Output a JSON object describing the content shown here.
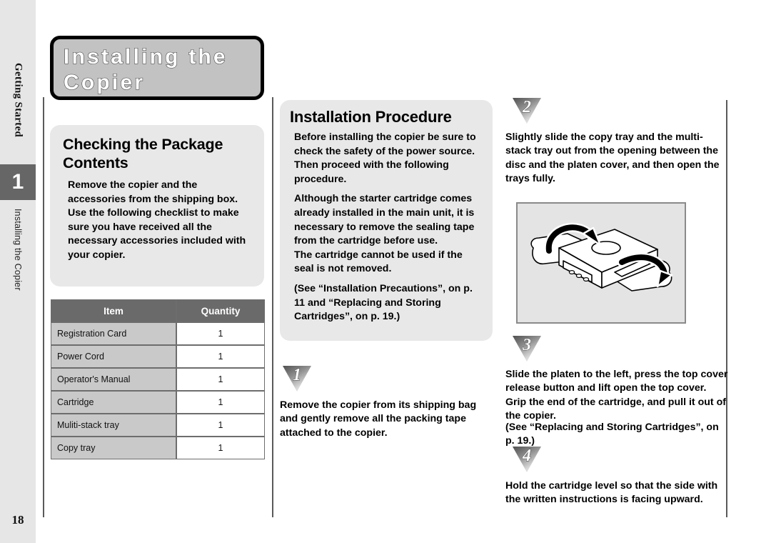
{
  "sidebar": {
    "chapter_label": "Getting Started",
    "tab_number": "1",
    "section_label": "Installing the Copier",
    "page_number": "18"
  },
  "banner": {
    "line1": "Installing the",
    "line2": "Copier"
  },
  "package_panel": {
    "heading": "Checking the Package Contents",
    "body": "Remove the copier and the accessories from the shipping box. Use the following checklist to make sure you have received all the necessary accessories included with your copier."
  },
  "package_table": {
    "headers": [
      "Item",
      "Quantity"
    ],
    "rows": [
      {
        "item": "Registration Card",
        "quantity": "1"
      },
      {
        "item": "Power Cord",
        "quantity": "1"
      },
      {
        "item": "Operator's Manual",
        "quantity": "1"
      },
      {
        "item": "Cartridge",
        "quantity": "1"
      },
      {
        "item": "Muliti-stack tray",
        "quantity": "1"
      },
      {
        "item": "Copy tray",
        "quantity": "1"
      }
    ]
  },
  "procedure_panel": {
    "heading": "Installation Procedure",
    "paragraph1": "Before installing the copier be sure to check the safety of the power source. Then proceed with the following procedure.",
    "paragraph2": "Although the starter cartridge comes already installed in the main unit, it is necessary to remove the sealing tape from the cartridge before use.",
    "paragraph3": "The cartridge cannot be used if the seal is not removed.",
    "paragraph4": "(See “Installation Precautions”, on p. 11 and “Replacing and Storing Cartridges”, on p. 19.)"
  },
  "steps": [
    {
      "number": "1",
      "text": "Remove the copier from its shipping bag and gently remove all the packing tape attached to the copier."
    },
    {
      "number": "2",
      "text": "Slightly slide the copy tray and the multi-stack tray out from the opening between the disc and the platen cover, and then open the trays fully."
    },
    {
      "number": "3",
      "text": "Slide the platen to the left, press the top cover release button and lift open the top cover. Grip the end of the cartridge, and pull it out of the copier.",
      "text2": "(See “Replacing and Storing Cartridges”, on p. 19.)"
    },
    {
      "number": "4",
      "text": "Hold the cartridge level so that the side with the written instructions is facing upward."
    }
  ],
  "illustration": {
    "name": "copier-open-trays-diagram"
  },
  "colors": {
    "panel_gray": "#e8e8e8",
    "banner_gray": "#c2c2c2",
    "tab_dark": "#666666",
    "table_header": "#6a6a6a",
    "table_item_cell": "#c9c9c9",
    "sidebar_gray": "#e6e6e6"
  }
}
